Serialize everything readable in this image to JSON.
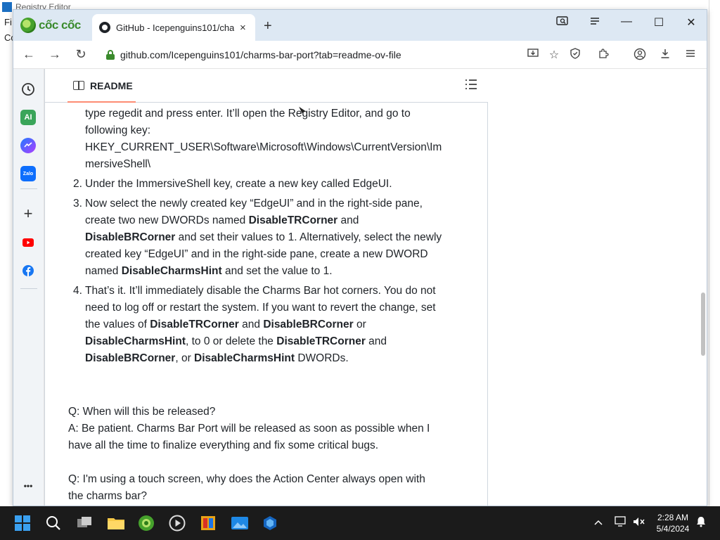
{
  "background_window": {
    "title": "Registry Editor",
    "menu_fragment": "Fi",
    "address_fragment": "Co"
  },
  "browser": {
    "brand": "cốc cốc",
    "tab": {
      "title": "GitHub - Icepenguins101/cha",
      "close": "×"
    },
    "new_tab": "+",
    "window_controls": {
      "minimize": "—",
      "maximize": "☐",
      "close": "✕"
    },
    "url": "github.com/Icepenguins101/charms-bar-port?tab=readme-ov-file",
    "nav": {
      "back": "←",
      "forward": "→",
      "reload": "↻"
    }
  },
  "readme": {
    "tab_label": "README",
    "step1_lines": [
      "type regedit and press enter. It’ll open the Registry Editor, and go to",
      "following key:",
      "HKEY_CURRENT_USER\\Software\\Microsoft\\Windows\\CurrentVersion\\Im",
      "mersiveShell\\"
    ],
    "step2": {
      "num": "2.",
      "text": "Under the ImmersiveShell key, create a new key called EdgeUI."
    },
    "step3": {
      "num": "3.",
      "a": "Now select the newly created key “EdgeUI” and in the right-side pane, create two new DWORDs named ",
      "k1": "DisableTRCorner",
      "b": " and ",
      "k2": "DisableBRCorner",
      "c": " and set their values to 1. Alternatively, select the newly created key “EdgeUI” and in the right-side pane, create a new DWORD named ",
      "k3": "DisableCharmsHint",
      "d": " and set the value to 1."
    },
    "step4": {
      "num": "4.",
      "a": "That’s it. It’ll immediately disable the Charms Bar hot corners. You do not need to log off or restart the system. If you want to revert the change, set the values of ",
      "k1": "DisableTRCorner",
      "b": " and ",
      "k2": "DisableBRCorner",
      "c": " or ",
      "k3": "DisableCharmsHint",
      "d": ", to 0 or delete the ",
      "k4": "DisableTRCorner",
      "e": " and ",
      "k5": "DisableBRCorner",
      "f": ", or ",
      "k6": "DisableCharmsHint",
      "g": " DWORDs."
    },
    "faq1_q": "Q: When will this be released?",
    "faq1_a": "A: Be patient. Charms Bar Port will be released as soon as possible when I have all the time to finalize everything and fix some critical bugs.",
    "faq2_q": "Q: I'm using a touch screen, why does the Action Center always open with the charms bar?"
  },
  "sidebar": {
    "items": [
      "history-icon",
      "ai-icon",
      "messenger-icon",
      "zalo-icon",
      "add-icon",
      "youtube-icon",
      "facebook-icon",
      "more-icon"
    ],
    "ai_label": "AI",
    "zalo_label": "Zalo",
    "more_label": "•••"
  },
  "taskbar": {
    "time": "2:28 AM",
    "date": "5/4/2024"
  },
  "colors": {
    "accent_green": "#3a8a2c",
    "tab_underline": "#fd8c73",
    "taskbar": "#1b1b1b"
  }
}
